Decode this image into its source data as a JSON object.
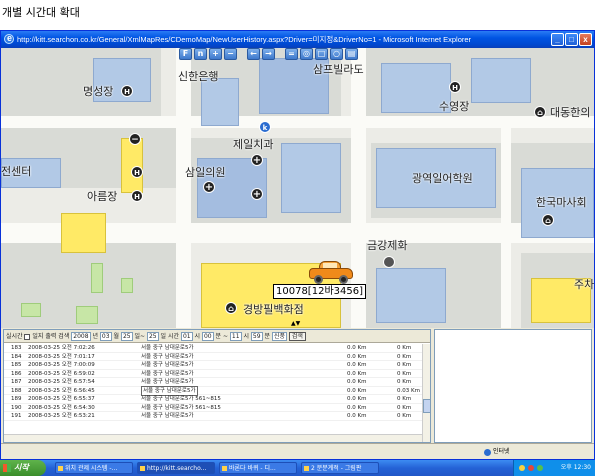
{
  "caption": "개별 시간대 확대",
  "window": {
    "title": "http://kitt.searchon.co.kr/General/XmlMapRes/CDemoMap/NewUserHistory.aspx?Driver=미지정&DriverNo=1 - Microsoft Internet Explorer",
    "min": "_",
    "max": "□",
    "close": "x"
  },
  "map": {
    "labels": {
      "shinhan": "신한은행",
      "sampeu": "삼프빌라도",
      "myeongseong": "명성장",
      "suyeong": "수영장",
      "daedonghan": "대동한의",
      "jeil": "제일치과",
      "samil": "삼일의원",
      "gwangyeok": "광역일어학원",
      "center": "전센터",
      "areumjang": "아름장",
      "hanguk": "한국마사회",
      "geumgang": "금강제화",
      "gyeongbang": "경방필백화점",
      "juchajang": "주차"
    },
    "vehicle_label": "10078[12바3456]",
    "collapse": "▲▼"
  },
  "filter": {
    "text1": "실시간",
    "text2": "일지 출력 검색",
    "year": "2008",
    "y_unit": "년",
    "month": "03",
    "m_unit": "월",
    "day": "25",
    "d_unit": "일~",
    "day2": "25",
    "d2_unit": "일 시간",
    "hour1": "01",
    "h1_unit": "시",
    "min1": "00",
    "m1_unit": "분 ~",
    "hour2": "11",
    "h2_unit": "시",
    "min2": "59",
    "m2_unit": "분",
    "kind": "신풍",
    "search": "검색"
  },
  "history": [
    {
      "no": "183",
      "dt": "2008-03-25 오전 7:02:26",
      "addr": "서울 중구 남대문로5가",
      "spd": "0.0 Km",
      "km": "0 Km"
    },
    {
      "no": "184",
      "dt": "2008-03-25 오전 7:01:17",
      "addr": "서울 중구 남대문로5가",
      "spd": "0.0 Km",
      "km": "0 Km"
    },
    {
      "no": "185",
      "dt": "2008-03-25 오전 7:00:09",
      "addr": "서울 중구 남대문로5가",
      "spd": "0.0 Km",
      "km": "0 Km"
    },
    {
      "no": "186",
      "dt": "2008-03-25 오전 6:59:02",
      "addr": "서울 중구 남대문로5가",
      "spd": "0.0 Km",
      "km": "0 Km"
    },
    {
      "no": "187",
      "dt": "2008-03-25 오전 6:57:54",
      "addr": "서울 중구 남대문로5가",
      "spd": "0.0 Km",
      "km": "0 Km"
    },
    {
      "no": "188",
      "dt": "2008-03-25 오전 6:56:45",
      "addr": "서울 중구 남대문로5가",
      "spd": "0.0 Km",
      "km": "0.03 Km"
    },
    {
      "no": "189",
      "dt": "2008-03-25 오전 6:55:37",
      "addr": "서울 중구 남대문로5가 561~815",
      "spd": "0.0 Km",
      "km": "0 Km"
    },
    {
      "no": "190",
      "dt": "2008-03-25 오전 6:54:30",
      "addr": "서울 중구 남대문로5가 561~815",
      "spd": "0.0 Km",
      "km": "0 Km"
    },
    {
      "no": "191",
      "dt": "2008-03-25 오전 6:53:21",
      "addr": "서울 중구 남대문로5가",
      "spd": "0.0 Km",
      "km": "0 Km"
    }
  ],
  "status": {
    "zone": "인터넷"
  },
  "taskbar": {
    "start": "시작",
    "tasks": [
      "위치 관제 시스템 -...",
      "http://kitt.searcho...",
      "바론다 바퀴 - 디...",
      "2 분분계적 - 그림판"
    ],
    "clock": "오후 12:30"
  }
}
